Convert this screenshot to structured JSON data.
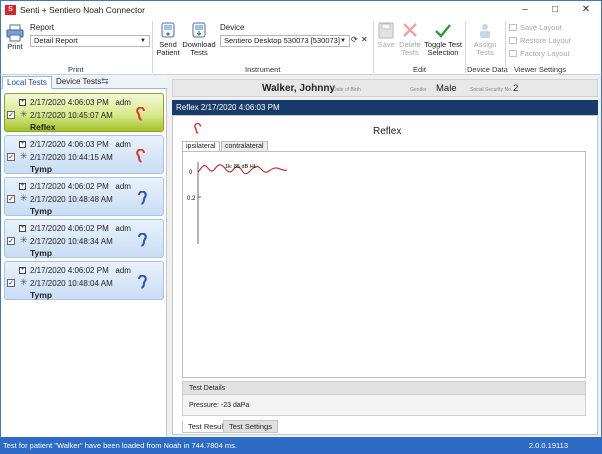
{
  "window": {
    "title": "Senti + Sentiero Noah Connector",
    "minimize": "–",
    "maximize": "□",
    "close": "✕"
  },
  "ribbon": {
    "print": {
      "print_label": "Print",
      "report_label": "Report",
      "report_value": "Detail Report",
      "group_label": "Print"
    },
    "instrument": {
      "send_patient": "Send\nPatient",
      "download_tests": "Download\nTests",
      "device_label": "Device",
      "device_value": "Sentiero Desktop 530073 [530073]",
      "group_label": "Instrument"
    },
    "edit": {
      "save": "Save",
      "delete_tests": "Delete\nTests",
      "toggle_selection": "Toggle Test\nSelection",
      "group_label": "Edit"
    },
    "device_data": {
      "assign_tests": "Assign\nTests",
      "group_label": "Device Data"
    },
    "viewer_settings": {
      "save_layout": "Save Layout",
      "restore_layout": "Restore Layout",
      "factory_layout": "Factory Layout",
      "group_label": "Viewer Settings"
    }
  },
  "left_tabs": {
    "local_tests": "Local Tests",
    "device_tests": "Device Tests"
  },
  "tests": [
    {
      "downloaded": "2/17/2020 4:06:03 PM",
      "user": "adm",
      "measured": "2/17/2020 10:45:07 AM",
      "name": "Reflex",
      "checked": true,
      "selected": true,
      "ear": "right",
      "ear_color": "#e03030"
    },
    {
      "downloaded": "2/17/2020 4:06:03 PM",
      "user": "adm",
      "measured": "2/17/2020 10:44:15 AM",
      "name": "Tymp",
      "checked": true,
      "selected": false,
      "ear": "right",
      "ear_color": "#e03030"
    },
    {
      "downloaded": "2/17/2020 4:06:02 PM",
      "user": "adm",
      "measured": "2/17/2020 10:48:48 AM",
      "name": "Tymp",
      "checked": true,
      "selected": false,
      "ear": "left",
      "ear_color": "#2a4fb8"
    },
    {
      "downloaded": "2/17/2020 4:06:02 PM",
      "user": "adm",
      "measured": "2/17/2020 10:48:34 AM",
      "name": "Tymp",
      "checked": true,
      "selected": false,
      "ear": "left",
      "ear_color": "#2a4fb8"
    },
    {
      "downloaded": "2/17/2020 4:06:02 PM",
      "user": "adm",
      "measured": "2/17/2020 10:48:04 AM",
      "name": "Tymp",
      "checked": true,
      "selected": false,
      "ear": "left",
      "ear_color": "#2a4fb8"
    }
  ],
  "patient": {
    "name": "Walker, Johnny",
    "dob_label": "Date of Birth",
    "gender_label": "Gender",
    "gender": "Male",
    "ssn_label": "Social Security No.",
    "ssn": "2"
  },
  "detail": {
    "header": "Reflex 2/17/2020 4:06:03 PM",
    "title": "Reflex",
    "tab_ipsilateral": "ipsilateral",
    "tab_contralateral": "contralateral",
    "curve_label": "1k: 85 dB HL",
    "y_ticks": [
      "0",
      "0.2"
    ],
    "test_details_label": "Test Details",
    "pressure": "Pressure: -23 daPa",
    "tab_test_result": "Test Result",
    "tab_test_settings": "Test Settings",
    "curve_color": "#c81e1e"
  },
  "status": {
    "message": "Test for patient \"Walker\" have been loaded from Noah in 744.7804 ms.",
    "version": "2.0.0.19113"
  }
}
